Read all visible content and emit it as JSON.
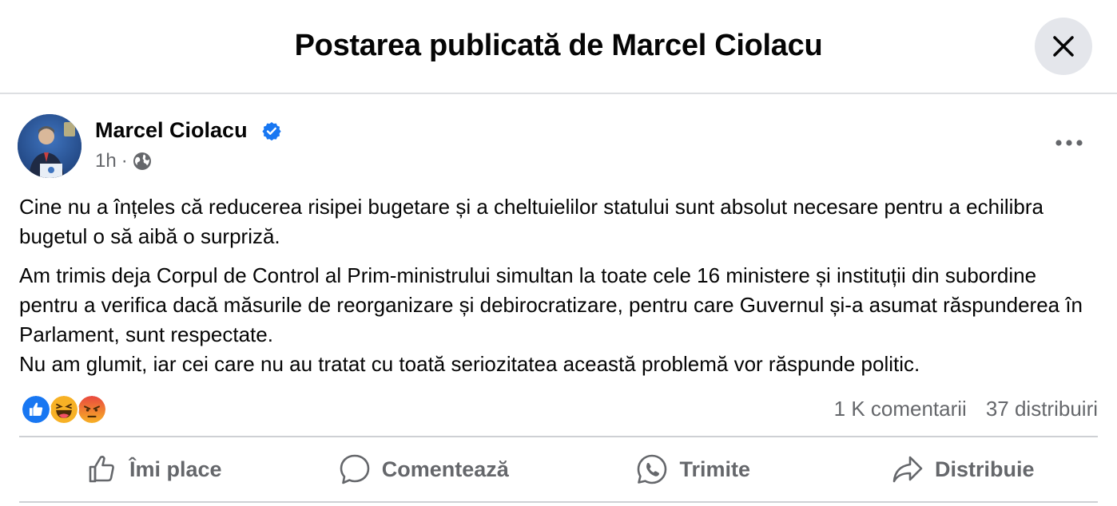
{
  "dialog": {
    "title": "Postarea publicată de Marcel Ciolacu",
    "close_icon": "close-icon"
  },
  "post": {
    "author": "Marcel Ciolacu",
    "verified": true,
    "time": "1h",
    "separator": "·",
    "audience_icon": "globe-icon",
    "paragraphs": [
      "Cine nu a înțeles că reducerea risipei bugetare și a cheltuielilor statului sunt absolut necesare pentru a echilibra bugetul o să aibă o surpriză.",
      "Am trimis deja Corpul de Control al Prim-ministrului simultan la toate cele 16 ministere și instituții din subordine pentru a verifica dacă măsurile de reorganizare și debirocratizare, pentru care Guvernul și-a asumat răspunderea în Parlament, sunt respectate.",
      "Nu am glumit, iar cei care nu au tratat cu toată seriozitatea această problemă vor răspunde politic."
    ]
  },
  "reactions": {
    "types": [
      "like",
      "haha",
      "angry"
    ],
    "comments": "1 K comentarii",
    "shares": "37 distribuiri"
  },
  "actions": [
    {
      "label": "Îmi place",
      "icon": "thumbs-up-icon"
    },
    {
      "label": "Comentează",
      "icon": "comment-icon"
    },
    {
      "label": "Trimite",
      "icon": "whatsapp-icon"
    },
    {
      "label": "Distribuie",
      "icon": "share-icon"
    }
  ],
  "colors": {
    "like": "#1877f2",
    "verified": "#1877f2",
    "secondary_text": "#65676b",
    "close_bg": "#e4e6eb"
  }
}
